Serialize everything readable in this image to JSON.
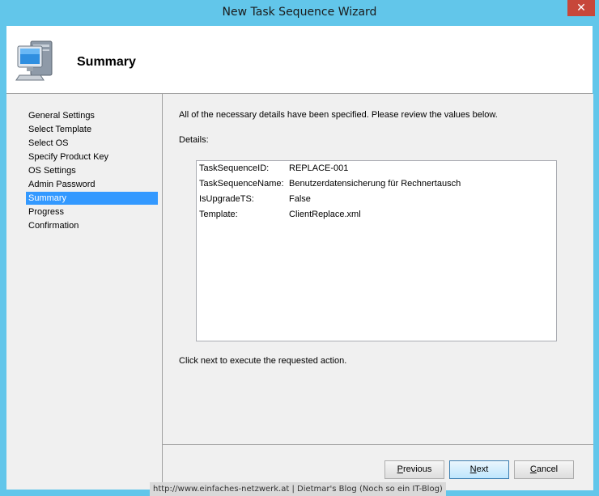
{
  "window": {
    "title": "New Task Sequence Wizard",
    "close_glyph": "✕"
  },
  "header": {
    "icon": "computer-icon",
    "title": "Summary"
  },
  "nav": {
    "items": [
      {
        "label": "General Settings",
        "active": false
      },
      {
        "label": "Select Template",
        "active": false
      },
      {
        "label": "Select OS",
        "active": false
      },
      {
        "label": "Specify Product Key",
        "active": false
      },
      {
        "label": "OS Settings",
        "active": false
      },
      {
        "label": "Admin Password",
        "active": false
      },
      {
        "label": "Summary",
        "active": true
      },
      {
        "label": "Progress",
        "active": false
      },
      {
        "label": "Confirmation",
        "active": false
      }
    ]
  },
  "main": {
    "intro": "All of the necessary details have been specified.  Please review the values below.",
    "details_label": "Details:",
    "details": [
      {
        "key": "TaskSequenceID:",
        "value": "REPLACE-001"
      },
      {
        "key": "TaskSequenceName:",
        "value": "Benutzerdatensicherung für Rechnertausch"
      },
      {
        "key": "IsUpgradeTS:",
        "value": "False"
      },
      {
        "key": "Template:",
        "value": "ClientReplace.xml"
      }
    ],
    "footer_note": "Click next to execute the requested action."
  },
  "buttons": {
    "previous": {
      "underlined": "P",
      "rest": "revious"
    },
    "next": {
      "underlined": "N",
      "rest": "ext"
    },
    "cancel": {
      "underlined": "C",
      "rest": "ancel"
    }
  },
  "watermark": "http://www.einfaches-netzwerk.at | Dietmar's Blog (Noch so ein IT-Blog)"
}
